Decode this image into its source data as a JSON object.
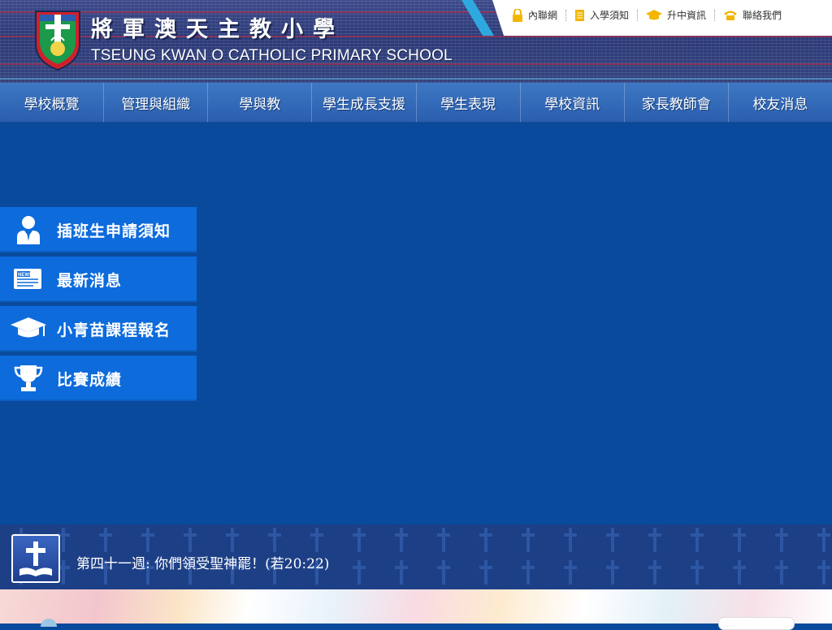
{
  "header": {
    "title_zh": "將軍澳天主教小學",
    "title_en": "TSEUNG KWAN O CATHOLIC PRIMARY SCHOOL"
  },
  "quick_links": [
    {
      "label": "內聯網",
      "icon": "lock-icon"
    },
    {
      "label": "入學須知",
      "icon": "document-icon"
    },
    {
      "label": "升中資訊",
      "icon": "graduation-cap-icon"
    },
    {
      "label": "聯絡我們",
      "icon": "phone-icon"
    }
  ],
  "nav": [
    {
      "label": "學校概覽"
    },
    {
      "label": "管理與組織"
    },
    {
      "label": "學與教"
    },
    {
      "label": "學生成長支援"
    },
    {
      "label": "學生表現"
    },
    {
      "label": "學校資訊"
    },
    {
      "label": "家長教師會"
    },
    {
      "label": "校友消息"
    }
  ],
  "side_menu": [
    {
      "label": "插班生申請須知",
      "icon": "person-icon"
    },
    {
      "label": "最新消息",
      "icon": "newspaper-icon"
    },
    {
      "label": "小青苗課程報名",
      "icon": "graduation-cap-icon"
    },
    {
      "label": "比賽成績",
      "icon": "trophy-icon"
    }
  ],
  "verse": {
    "text": "第四十一週: 你們領受聖神罷！(若20:22)",
    "icon": "cross-bible-icon"
  },
  "colors": {
    "main_bg": "#0a4a9c",
    "side_button": "#0d6bdc",
    "nav_bg": "#2a5eae",
    "accent": "#2ea9e0",
    "quicklink_icon": "#f2b600"
  }
}
